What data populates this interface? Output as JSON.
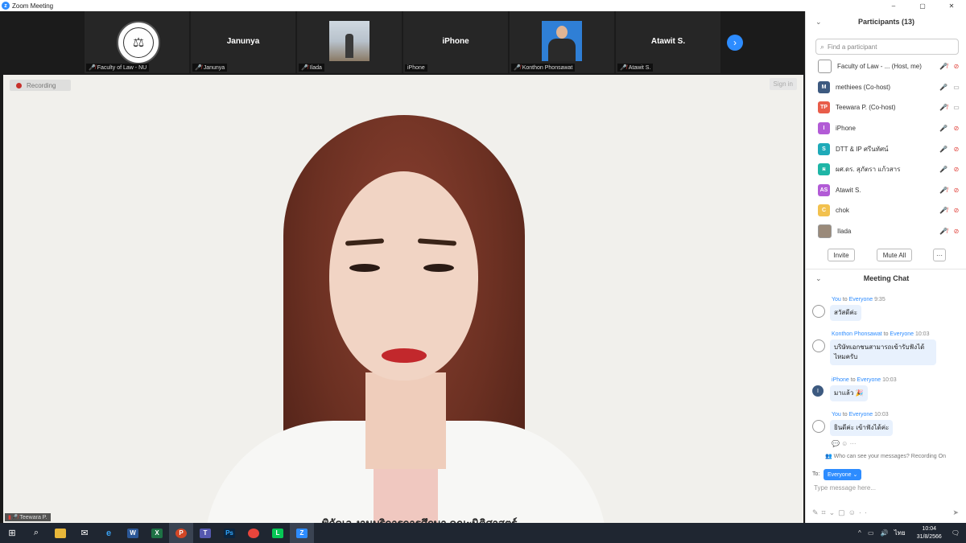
{
  "window": {
    "title": "Zoom Meeting",
    "minimize": "–",
    "maximize": "▢",
    "close": "✕"
  },
  "strip": {
    "tiles": [
      {
        "display": "",
        "caption": "Faculty of Law - NU"
      },
      {
        "display": "Janunya",
        "caption": "Janunya"
      },
      {
        "display": "",
        "caption": "Ilada"
      },
      {
        "display": "iPhone",
        "caption": "iPhone"
      },
      {
        "display": "",
        "caption": "Konthon Phonsawat"
      },
      {
        "display": "Atawit S.",
        "caption": "Atawit S."
      }
    ],
    "next_icon": "›"
  },
  "main": {
    "recording_label": "Recording",
    "signin_label": "Sign in",
    "speaker_caption": "Teewara P.",
    "bottom_overlay_text": "พิกัดเอ งานบริการการศึกษา คณะนิติศาสตร์"
  },
  "participants": {
    "header": "Participants (13)",
    "search_placeholder": "Find a participant",
    "items": [
      {
        "name": "Faculty of Law - ... (Host, me)",
        "initials": "",
        "color": "#ffffff",
        "mic": "muted",
        "cam": "off"
      },
      {
        "name": "methiees (Co-host)",
        "initials": "M",
        "color": "#3d5a80",
        "mic": "on",
        "cam": "on"
      },
      {
        "name": "Teewara P. (Co-host)",
        "initials": "TP",
        "color": "#e85d4a",
        "mic": "muted",
        "cam": "on"
      },
      {
        "name": "iPhone",
        "initials": "I",
        "color": "#b25bd6",
        "mic": "on",
        "cam": "off"
      },
      {
        "name": "DTT & IP ศรีนทัศน์",
        "initials": "S",
        "color": "#1eaab8",
        "mic": "on",
        "cam": "off"
      },
      {
        "name": "ผศ.ดร. สุภัตรา แก้วสาร",
        "initials": "ผ",
        "color": "#1eb5a6",
        "mic": "on",
        "cam": "off"
      },
      {
        "name": "Atawit S.",
        "initials": "AS",
        "color": "#b25bd6",
        "mic": "muted",
        "cam": "off"
      },
      {
        "name": "chok",
        "initials": "C",
        "color": "#f2c14e",
        "mic": "muted",
        "cam": "off"
      },
      {
        "name": "Ilada",
        "initials": "",
        "color": "#9a8a7a",
        "mic": "muted",
        "cam": "off"
      }
    ],
    "invite_label": "Invite",
    "mute_all_label": "Mute All",
    "more_label": "···"
  },
  "chat": {
    "header": "Meeting Chat",
    "messages": [
      {
        "from": "You",
        "to": "Everyone",
        "time": "9:35",
        "text": "สวัสดีค่ะ",
        "avatar": "",
        "avatar_color": "#ffffff"
      },
      {
        "from": "Konthon Phonsawat",
        "to": "Everyone",
        "time": "10:03",
        "text": "บริษัทเอกชนสามารถเข้ารับฟังได้ไหมครับ",
        "avatar": "",
        "avatar_color": "#ffffff"
      },
      {
        "from": "iPhone",
        "to": "Everyone",
        "time": "10:03",
        "text": "มาแล้ว 🎉",
        "avatar": "I",
        "avatar_color": "#3d5a80"
      },
      {
        "from": "You",
        "to": "Everyone",
        "time": "10:03",
        "text": "ยินดีค่ะ เข้าฟังได้ค่ะ",
        "avatar": "",
        "avatar_color": "#ffffff"
      }
    ],
    "to_word": "to",
    "notice": "Who can see your messages? Recording On",
    "to_label": "To:",
    "recipient": "Everyone ⌄",
    "placeholder": "Type message here..."
  },
  "taskbar": {
    "time": "10:04",
    "date": "31/8/2566",
    "lang": "ไทย"
  }
}
